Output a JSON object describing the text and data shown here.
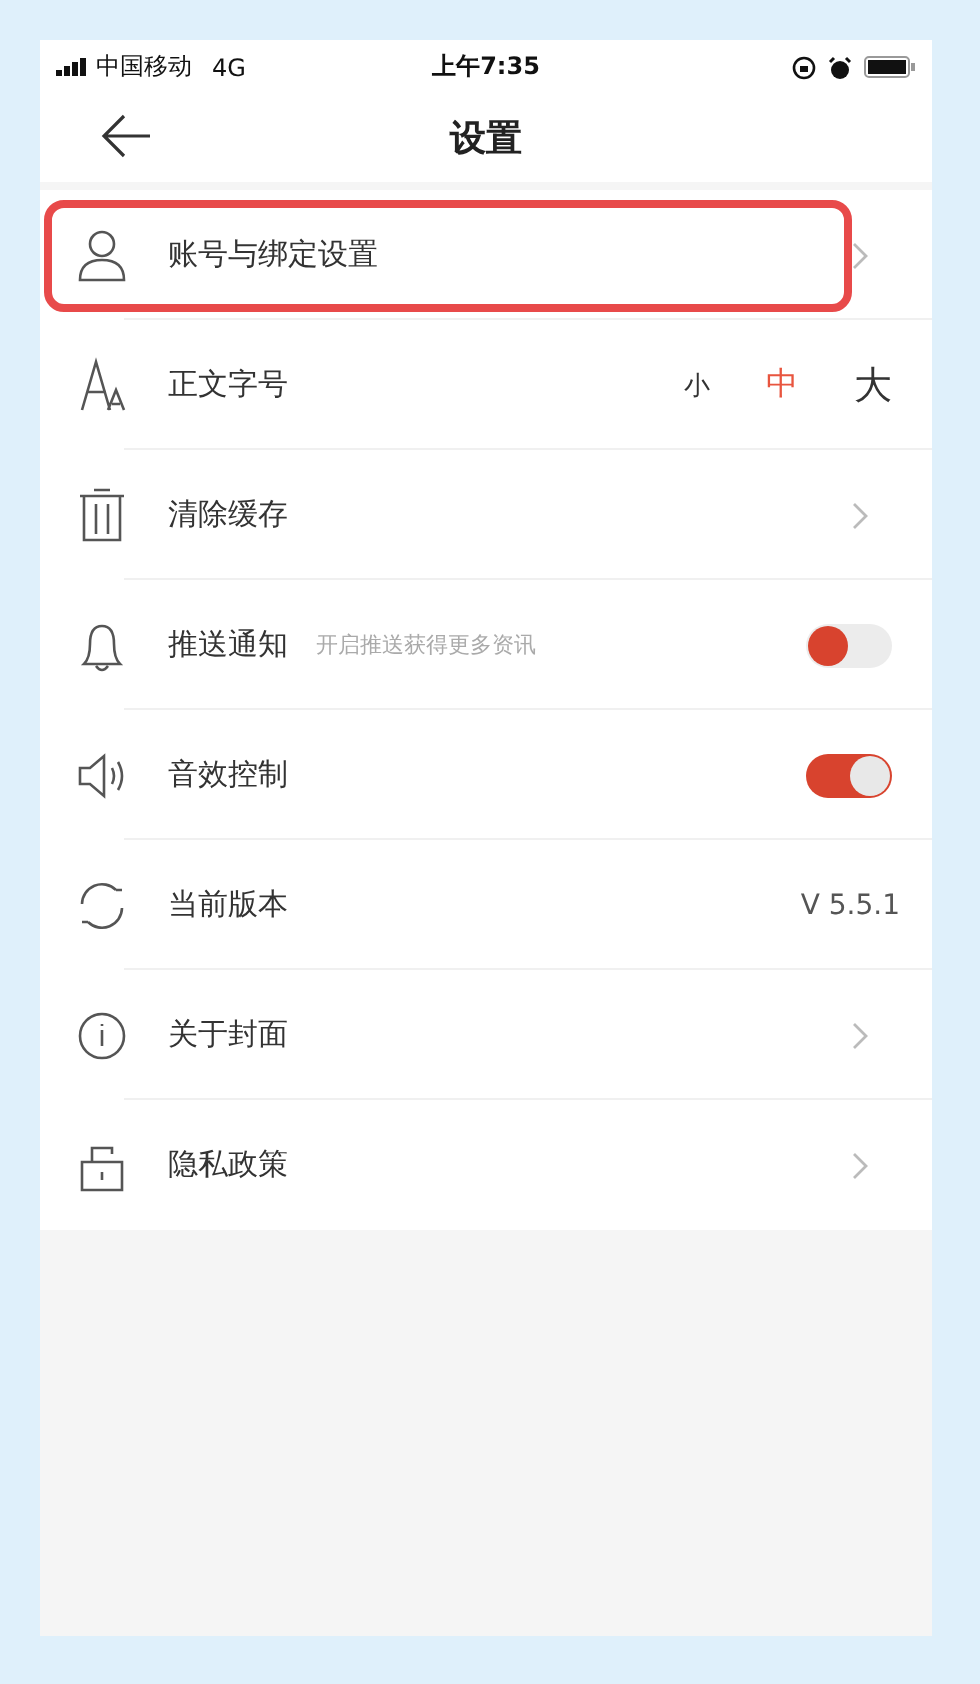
{
  "status_bar": {
    "carrier": "中国移动",
    "network": "4G",
    "time": "上午7:35"
  },
  "header": {
    "title": "设置"
  },
  "items": [
    {
      "kind": "link",
      "label": "账号与绑定设置",
      "highlighted": true
    },
    {
      "kind": "font_size",
      "label": "正文字号",
      "highlighted": false,
      "options": [
        {
          "label": "小",
          "selected": false
        },
        {
          "label": "中",
          "selected": true
        },
        {
          "label": "大",
          "selected": false
        }
      ]
    },
    {
      "kind": "link",
      "label": "清除缓存",
      "highlighted": false
    },
    {
      "kind": "toggle",
      "label": "推送通知",
      "highlighted": false,
      "hint": "开启推送获得更多资讯",
      "on": false
    },
    {
      "kind": "toggle",
      "label": "音效控制",
      "highlighted": false,
      "on": true
    },
    {
      "kind": "value",
      "label": "当前版本",
      "highlighted": false,
      "value": "V 5.5.1"
    },
    {
      "kind": "link",
      "label": "关于封面",
      "highlighted": false
    },
    {
      "kind": "link",
      "label": "隐私政策",
      "highlighted": false
    }
  ]
}
